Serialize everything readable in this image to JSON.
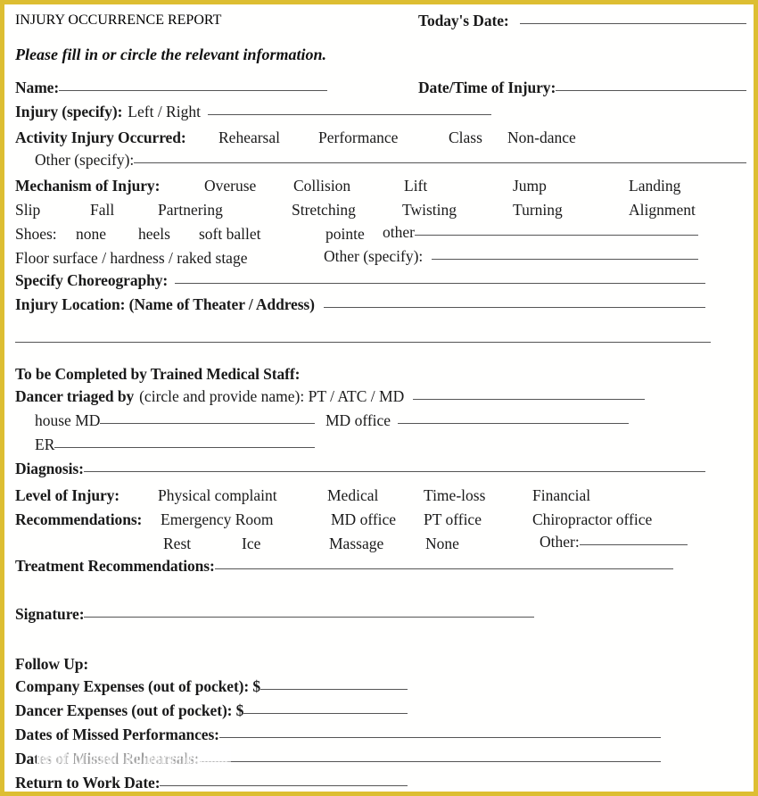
{
  "document": {
    "title": "INJURY OCCURRENCE REPORT",
    "subtitle": "Please fill in or circle the relevant information.",
    "border_color": "#ddbe32",
    "rule_color": "#555555",
    "text_color": "#1a1a1a"
  },
  "header": {
    "todays_date_label": "Today's Date:"
  },
  "identity": {
    "name_label": "Name:",
    "datetime_label": "Date/Time of Injury:"
  },
  "injury": {
    "specify_label": "Injury (specify):",
    "side_options": "Left / Right"
  },
  "activity": {
    "label": "Activity Injury Occurred:",
    "options": [
      "Rehearsal",
      "Performance",
      "Class",
      "Non-dance"
    ],
    "other_label": "Other (specify):"
  },
  "mechanism": {
    "label": "Mechanism of Injury:",
    "row1": [
      "Overuse",
      "Collision",
      "Lift",
      "Jump",
      "Landing"
    ],
    "row2": [
      "Slip",
      "Fall",
      "Partnering",
      "Stretching",
      "Twisting",
      "Turning",
      "Alignment"
    ]
  },
  "shoes": {
    "label": "Shoes:",
    "options": [
      "none",
      "heels",
      "soft ballet",
      "pointe"
    ],
    "other_label": "other"
  },
  "floor": {
    "label": "Floor surface / hardness / raked stage",
    "other_label": "Other (specify):"
  },
  "choreography": {
    "label": "Specify Choreography:"
  },
  "location": {
    "label": "Injury Location: (Name of Theater / Address)"
  },
  "medical": {
    "section_heading": "To be Completed by Trained Medical Staff:",
    "triage_label_bold": "Dancer triaged by",
    "triage_label_rest": "(circle and provide name): PT / ATC / MD",
    "house_md_label": "house MD",
    "md_office_label": "MD office",
    "er_label": "ER",
    "diagnosis_label": "Diagnosis:"
  },
  "level_of_injury": {
    "label": "Level of Injury:",
    "options": [
      "Physical complaint",
      "Medical",
      "Time-loss",
      "Financial"
    ]
  },
  "recommendations": {
    "label": "Recommendations:",
    "row1": [
      "Emergency Room",
      "MD office",
      "PT office",
      "Chiropractor office"
    ],
    "row2": [
      "Rest",
      "Ice",
      "Massage",
      "None"
    ],
    "other_label": "Other:",
    "treatment_label": "Treatment Recommendations:"
  },
  "signature": {
    "label": "Signature:"
  },
  "follow_up": {
    "heading": "Follow Up:",
    "company_expenses_label": "Company Expenses (out of pocket): $",
    "dancer_expenses_label": "Dancer Expenses (out of pocket): $",
    "missed_performances_label": "Dates of Missed Performances:",
    "missed_rehearsals_label": "Dates of Missed Rehearsals:",
    "return_to_work_label": "Return to Work Date:"
  }
}
